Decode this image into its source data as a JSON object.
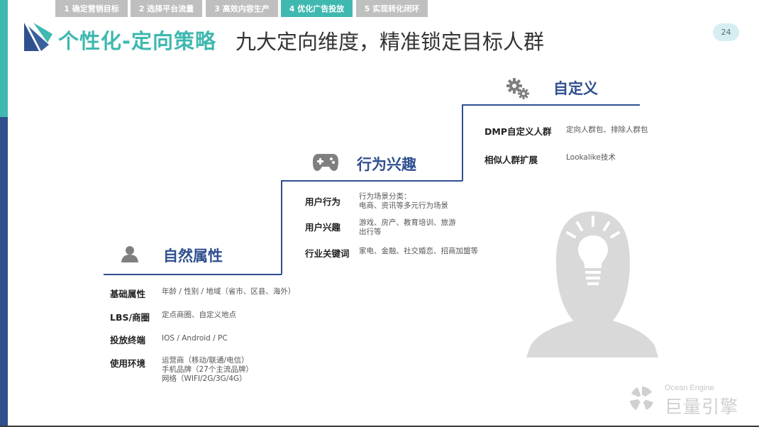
{
  "steps": [
    "1 确定营销目标",
    "2 选择平台流量",
    "3 高效内容生产",
    "4 优化广告投放",
    "5 实现转化闭环"
  ],
  "page_number": "24",
  "title": {
    "accent": "个性化-定向策略",
    "rest": "九大定向维度，精准锁定目标人群"
  },
  "natural": {
    "header": "自然属性",
    "rows": [
      {
        "label": "基础属性",
        "value": [
          "年龄 / 性别 / 地域（省市、区县、海外）"
        ]
      },
      {
        "label": "LBS/商圈",
        "value": [
          "定点商圈、自定义地点"
        ]
      },
      {
        "label": "投放终端",
        "value": [
          "IOS / Android / PC"
        ]
      },
      {
        "label": "使用环境",
        "value": [
          "运营商（移动/联通/电信）",
          "手机品牌（27个主流品牌）",
          "网络（WIFI/2G/3G/4G）"
        ]
      }
    ]
  },
  "behavior": {
    "header": "行为兴趣",
    "rows": [
      {
        "label": "用户行为",
        "value": [
          "行为场景分类：",
          "电商、资讯等多元行为场景"
        ]
      },
      {
        "label": "用户兴趣",
        "value": [
          "游戏、房产、教育培训、旅游",
          "出行等"
        ]
      },
      {
        "label": "行业关键词",
        "value": [
          "家电、金融、社交婚恋、招商加盟等"
        ]
      }
    ]
  },
  "custom": {
    "header": "自定义",
    "rows": [
      {
        "label": "DMP自定义人群",
        "value": [
          "定向人群包、排除人群包"
        ]
      },
      {
        "label": "相似人群扩展",
        "value": [
          "Lookalike技术"
        ]
      }
    ]
  },
  "brand": {
    "en": "Ocean Engine",
    "cn": "巨量引擎"
  },
  "colors": {
    "teal": "#3fb8b0",
    "navy": "#2f4f8f",
    "tab_gray": "#bfbfbf",
    "icon_gray": "#7f7f7f",
    "silhouette": "#d9d9d9"
  }
}
